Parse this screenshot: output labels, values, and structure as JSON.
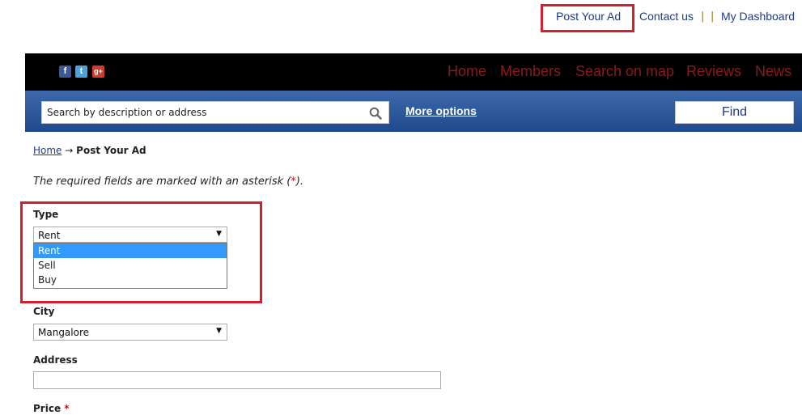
{
  "top_links": {
    "post_ad": "Post Your Ad",
    "contact": "Contact us",
    "sep": "|",
    "dashboard": "My Dashboard"
  },
  "social": {
    "facebook": "f",
    "twitter": "t",
    "googleplus": "g+"
  },
  "nav": {
    "items": [
      "Home",
      "Members",
      "Search on map",
      "Reviews",
      "News"
    ]
  },
  "search": {
    "placeholder": "Search by description or address",
    "more_options": "More options",
    "find": "Find"
  },
  "breadcrumb": {
    "home": "Home",
    "arrow": "→",
    "current": "Post Your Ad"
  },
  "form": {
    "required_note_prefix": "The required fields are marked with an asterisk (",
    "required_note_ast": "*",
    "required_note_suffix": ").",
    "type_label": "Type",
    "type_value": "Rent",
    "type_options": [
      "Rent",
      "Sell",
      "Buy"
    ],
    "city_label": "City",
    "city_value": "Mangalore",
    "address_label": "Address",
    "address_value": "",
    "price_label": "Price",
    "price_ast": "*"
  },
  "colors": {
    "highlight": "#d51f2e",
    "nav_text": "#8b1a1a",
    "link": "#1f3a8a",
    "selected_option": "#3399ff"
  }
}
